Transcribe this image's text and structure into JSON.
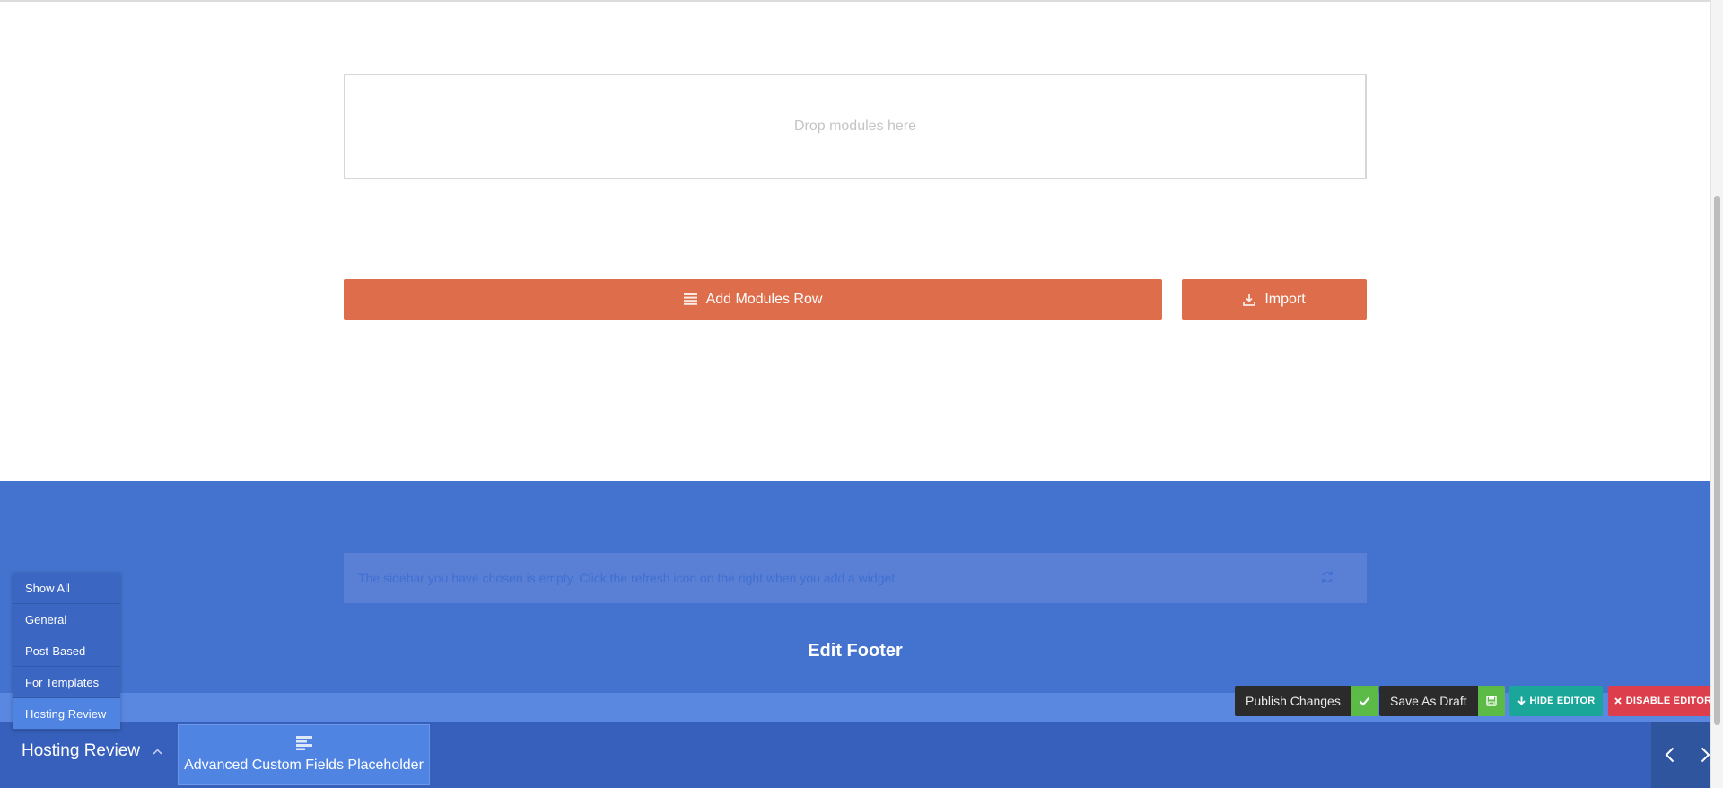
{
  "builder": {
    "drop_placeholder": "Drop modules here",
    "add_row_label": "Add Modules Row",
    "import_label": "Import"
  },
  "footer": {
    "sidebar_notice": "The sidebar you have chosen is empty. Click the refresh icon on the right when you add a widget.",
    "edit_label": "Edit Footer"
  },
  "actions": {
    "publish_label": "Publish Changes",
    "draft_label": "Save As Draft",
    "hide_label": "HIDE EDITOR",
    "disable_label": "DISABLE EDITOR"
  },
  "filter_menu": {
    "items": [
      {
        "label": "Show All"
      },
      {
        "label": "General"
      },
      {
        "label": "Post-Based"
      },
      {
        "label": "For Templates"
      },
      {
        "label": "Hosting Review"
      }
    ],
    "selected": "Hosting Review"
  },
  "bottom_bar": {
    "current_filter": "Hosting Review",
    "module_label": "Advanced Custom Fields Placeholder"
  },
  "icons": {
    "rows": "rows-icon",
    "import": "download-icon",
    "refresh": "refresh-icon",
    "check": "check-icon",
    "save": "floppy-icon",
    "hide": "arrow-down-icon",
    "disable": "close-icon",
    "chevron": "chevron-up-icon",
    "module": "fields-icon",
    "prev": "chevron-left-icon",
    "next": "chevron-right-icon"
  },
  "colors": {
    "orange": "#de6e4b",
    "footer_blue": "#4373cf",
    "bar_blue": "#3660bb",
    "green": "#5cbb46",
    "teal": "#1aa79a",
    "red": "#dc3f4b"
  }
}
